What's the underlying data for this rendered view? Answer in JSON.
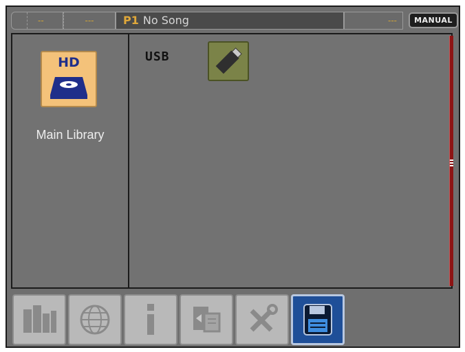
{
  "status_bar": {
    "seg1_a": "--",
    "seg1_b": "---",
    "performance_id": "P1",
    "song_name": "No Song",
    "seg4": "---",
    "mode_button": "MANUAL"
  },
  "left_panel": {
    "device_tile_text": "HD",
    "device_label": "Main Library"
  },
  "right_panel": {
    "usb_label": "USB"
  },
  "toolbar": {
    "buttons": [
      {
        "name": "library",
        "icon": "books-icon",
        "active": false
      },
      {
        "name": "web",
        "icon": "globe-icon",
        "active": false
      },
      {
        "name": "info",
        "icon": "info-icon",
        "active": false
      },
      {
        "name": "copy",
        "icon": "copy-icon",
        "active": false
      },
      {
        "name": "tools",
        "icon": "tools-icon",
        "active": false
      },
      {
        "name": "media",
        "icon": "floppy-disk-icon",
        "active": true
      }
    ]
  },
  "colors": {
    "accent_orange": "#d3a535",
    "active_blue": "#1f4f98",
    "scrollbar_red": "#8c1414",
    "hd_tile": "#f4c27a",
    "usb_tile": "#7b8348"
  }
}
